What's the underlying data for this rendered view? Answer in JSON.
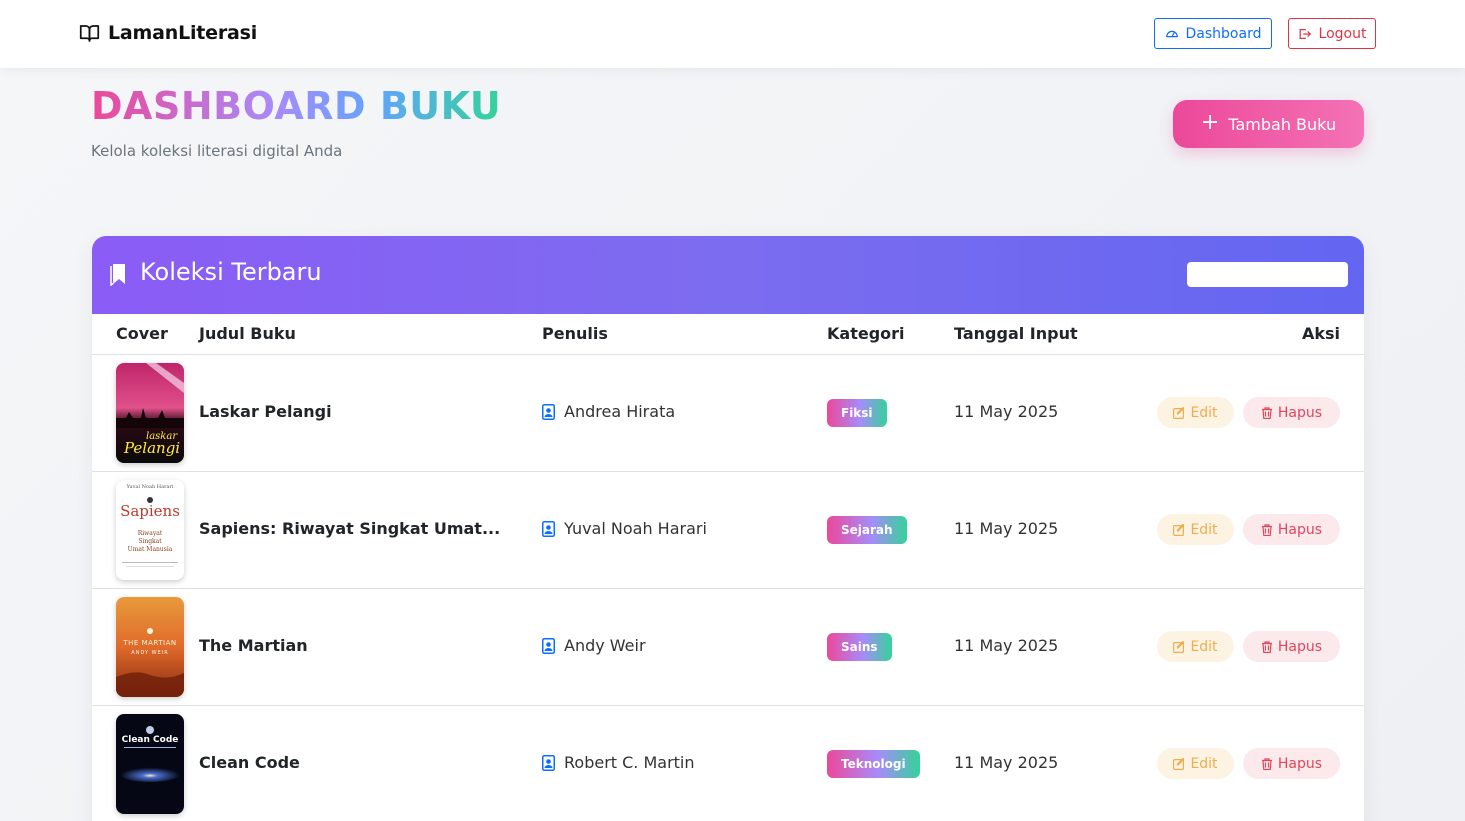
{
  "navbar": {
    "brand": "LamanLiterasi",
    "dashboard_label": "Dashboard",
    "logout_label": "Logout"
  },
  "header": {
    "title": "DASHBOARD BUKU",
    "subtitle": "Kelola koleksi literasi digital Anda",
    "add_button_label": "Tambah Buku"
  },
  "card": {
    "title": "Koleksi Terbaru",
    "search_value": ""
  },
  "table": {
    "columns": [
      "Cover",
      "Judul Buku",
      "Penulis",
      "Kategori",
      "Tanggal Input",
      "Aksi"
    ],
    "rows": [
      {
        "title": "Laskar Pelangi",
        "author": "Andrea Hirata",
        "category": "Fiksi",
        "date": "11 May 2025",
        "edit": "Edit",
        "delete": "Hapus"
      },
      {
        "title": "Sapiens: Riwayat Singkat Umat...",
        "author": "Yuval Noah Harari",
        "category": "Sejarah",
        "date": "11 May 2025",
        "edit": "Edit",
        "delete": "Hapus"
      },
      {
        "title": "The Martian",
        "author": "Andy Weir",
        "category": "Sains",
        "date": "11 May 2025",
        "edit": "Edit",
        "delete": "Hapus"
      },
      {
        "title": "Clean Code",
        "author": "Robert C. Martin",
        "category": "Teknologi",
        "date": "11 May 2025",
        "edit": "Edit",
        "delete": "Hapus"
      }
    ]
  },
  "covers": [
    {
      "lines": [
        "laskar",
        "Pelangi"
      ]
    },
    {
      "lines": [
        "Yuval Noah Harari",
        "Sapiens",
        "Riwayat",
        "Singkat",
        "Umat Manusia"
      ]
    },
    {
      "lines": [
        "THE MARTIAN",
        "ANDY WEIR"
      ]
    },
    {
      "lines": [
        "Clean Code"
      ]
    }
  ],
  "colors": {
    "accent_primary": "#0d6efd",
    "accent_danger": "#dc3545",
    "header_gradient_start": "#8b5cf6",
    "header_gradient_end": "#6366f1",
    "add_button": "#ec4899"
  }
}
